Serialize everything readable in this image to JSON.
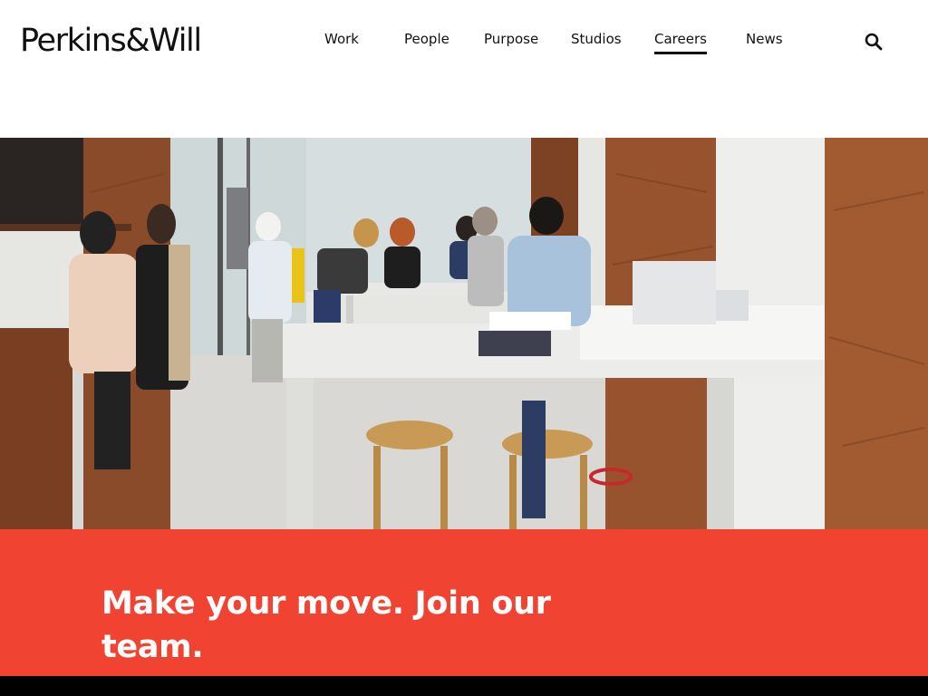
{
  "brand": {
    "logo_text": "Perkins&Will"
  },
  "nav": {
    "items": [
      {
        "label": "Work"
      },
      {
        "label": "People"
      },
      {
        "label": "Purpose"
      },
      {
        "label": "Studios"
      },
      {
        "label": "Careers",
        "active": true
      },
      {
        "label": "News"
      }
    ],
    "search_icon": "search-icon"
  },
  "hero": {
    "image": "office-collaboration-space-photo"
  },
  "banner": {
    "title": "Make your move. Join our team.",
    "background_color": "#f04332",
    "text_color": "#ffffff"
  }
}
